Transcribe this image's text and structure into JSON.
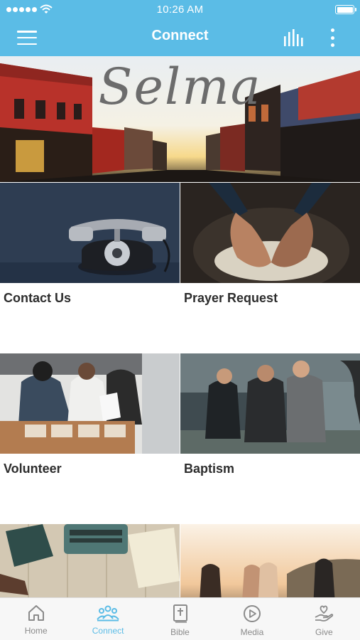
{
  "status_bar": {
    "time": "10:26 AM"
  },
  "navbar": {
    "title": "Connect",
    "menu_icon": "hamburger-menu-icon",
    "actions": [
      "audio-bars-icon",
      "more-vertical-icon"
    ]
  },
  "hero": {
    "title": "Selma"
  },
  "tiles": [
    {
      "label": "Contact Us"
    },
    {
      "label": "Prayer Request"
    },
    {
      "label": "Volunteer"
    },
    {
      "label": "Baptism"
    }
  ],
  "tabbar": {
    "items": [
      {
        "label": "Home",
        "icon": "home-icon"
      },
      {
        "label": "Connect",
        "icon": "people-group-icon"
      },
      {
        "label": "Bible",
        "icon": "bible-icon"
      },
      {
        "label": "Media",
        "icon": "play-circle-icon"
      },
      {
        "label": "Give",
        "icon": "hand-heart-icon"
      }
    ],
    "active_index": 1
  },
  "colors": {
    "accent": "#5bbce6",
    "tab_inactive": "#8a8a8a",
    "label_text": "#2d2d2d"
  }
}
